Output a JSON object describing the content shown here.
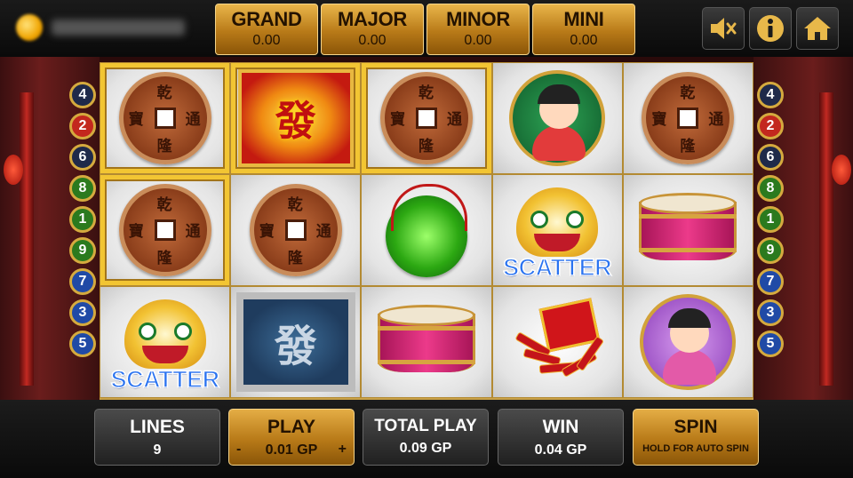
{
  "jackpots": [
    {
      "label": "GRAND",
      "value": "0.00"
    },
    {
      "label": "MAJOR",
      "value": "0.00"
    },
    {
      "label": "MINOR",
      "value": "0.00"
    },
    {
      "label": "MINI",
      "value": "0.00"
    }
  ],
  "top_buttons": {
    "mute_icon": "speaker-muted-icon",
    "info_icon": "info-icon",
    "home_icon": "home-icon"
  },
  "paylines_left": [
    "4",
    "2",
    "6",
    "8",
    "1",
    "9",
    "7",
    "3",
    "5"
  ],
  "paylines_right": [
    "4",
    "2",
    "6",
    "8",
    "1",
    "9",
    "7",
    "3",
    "5"
  ],
  "reels": [
    [
      "coin",
      "fa-red",
      "coin",
      "boy",
      "coin"
    ],
    [
      "coin",
      "coin",
      "jade",
      "lion-scatter",
      "drum"
    ],
    [
      "lion-scatter",
      "fa-blue",
      "drum",
      "firecracker",
      "girl"
    ]
  ],
  "coin_characters": [
    "乾",
    "通",
    "隆",
    "寶"
  ],
  "fa_character": "發",
  "scatter_label": "SCATTER",
  "bottom": {
    "lines": {
      "label": "LINES",
      "value": "9"
    },
    "play": {
      "label": "PLAY",
      "value": "0.01 GP",
      "minus": "-",
      "plus": "+"
    },
    "total_play": {
      "label": "TOTAL PLAY",
      "value": "0.09 GP"
    },
    "win": {
      "label": "WIN",
      "value": "0.04 GP"
    },
    "spin": {
      "label": "SPIN",
      "sub": "HOLD FOR AUTO SPIN"
    }
  },
  "colors": {
    "gold": "#d5aa3e",
    "accent_red": "#c3281e",
    "scatter_blue": "#2a73f0"
  }
}
